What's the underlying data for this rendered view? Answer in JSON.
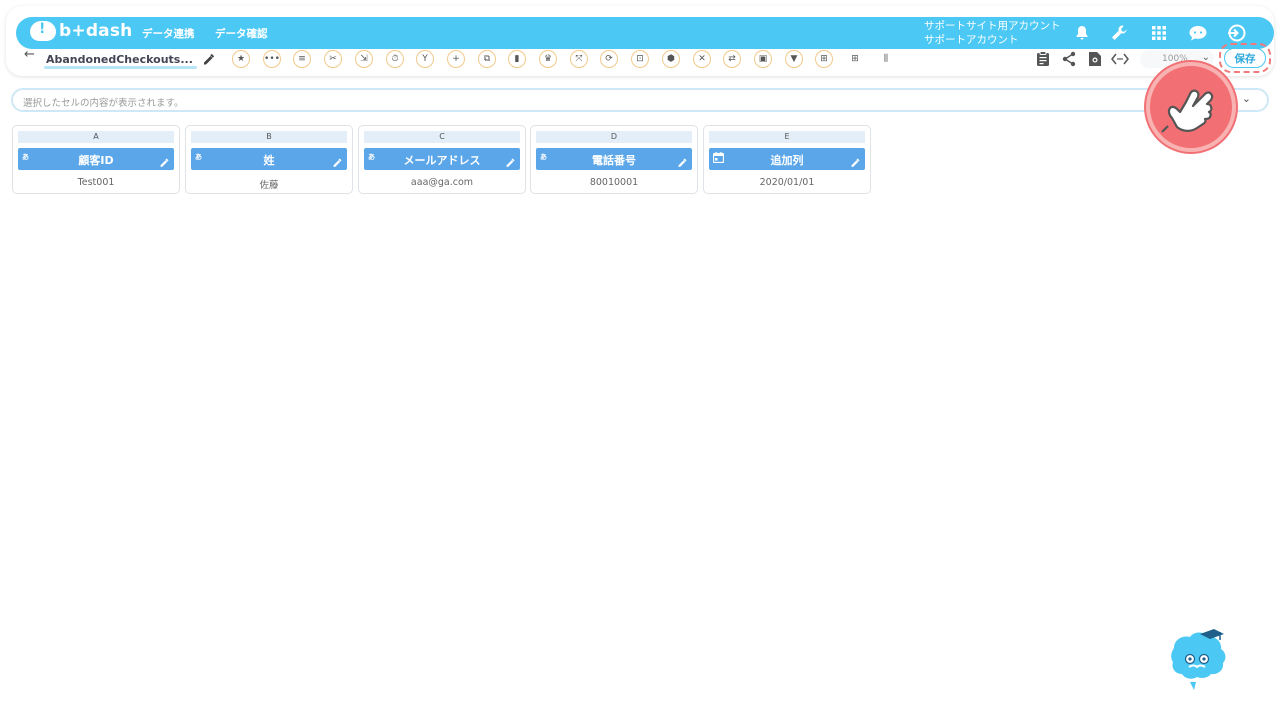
{
  "app": {
    "logo_text": "b+dash"
  },
  "nav": {
    "items": [
      "データ連携",
      "データ確認"
    ]
  },
  "account": {
    "line1": "サポートサイト用アカウント",
    "line2": "サポートアカウント"
  },
  "toolbar": {
    "back_label": "←",
    "file_name": "AbandonedCheckouts...",
    "zoom_value": "100%",
    "zoom_caret": "⌄",
    "save_label": "保存",
    "tools": [
      {
        "name": "star-icon",
        "glyph": "★"
      },
      {
        "name": "more-icon",
        "glyph": "•••"
      },
      {
        "name": "list-icon",
        "glyph": "≡"
      },
      {
        "name": "scissors-icon",
        "glyph": "✂"
      },
      {
        "name": "merge-icon",
        "glyph": "⇲"
      },
      {
        "name": "timer-icon",
        "glyph": "⏱"
      },
      {
        "name": "branch-icon",
        "glyph": "Y"
      },
      {
        "name": "plus-icon",
        "glyph": "+"
      },
      {
        "name": "copy-icon",
        "glyph": "⧉"
      },
      {
        "name": "trash-icon",
        "glyph": "▮"
      },
      {
        "name": "crown-icon",
        "glyph": "♛"
      },
      {
        "name": "expand-icon",
        "glyph": "⤧"
      },
      {
        "name": "repeat-icon",
        "glyph": "⟳"
      },
      {
        "name": "unlock-icon",
        "glyph": "⊡"
      },
      {
        "name": "box-icon",
        "glyph": "⬢"
      },
      {
        "name": "close-circle-icon",
        "glyph": "✕"
      },
      {
        "name": "convert-icon",
        "glyph": "⇄"
      },
      {
        "name": "frame-icon",
        "glyph": "▣"
      },
      {
        "name": "filter-icon",
        "glyph": "▼"
      },
      {
        "name": "grid-text-icon",
        "glyph": "⊞"
      },
      {
        "name": "table-icon",
        "glyph": "⊞"
      },
      {
        "name": "columns-icon",
        "glyph": "⫼"
      }
    ]
  },
  "cellbar": {
    "placeholder": "選択したセルの内容が表示されます。",
    "caret": "⌄"
  },
  "columns": [
    {
      "letter": "A",
      "type": "あ",
      "name": "顧客ID",
      "value": "Test001",
      "icon": "text-type-icon"
    },
    {
      "letter": "B",
      "type": "あ",
      "name": "姓",
      "value": "佐藤",
      "icon": "text-type-icon"
    },
    {
      "letter": "C",
      "type": "あ",
      "name": "メールアドレス",
      "value": "aaa@ga.com",
      "icon": "text-type-icon"
    },
    {
      "letter": "D",
      "type": "あ",
      "name": "電話番号",
      "value": "80010001",
      "icon": "text-type-icon"
    },
    {
      "letter": "E",
      "type": "",
      "name": "追加列",
      "value": "2020/01/01",
      "icon": "calendar-icon"
    }
  ],
  "colors": {
    "brand": "#4cc8f4",
    "column_header": "#5ba6e8",
    "highlight": "#f26f73"
  }
}
